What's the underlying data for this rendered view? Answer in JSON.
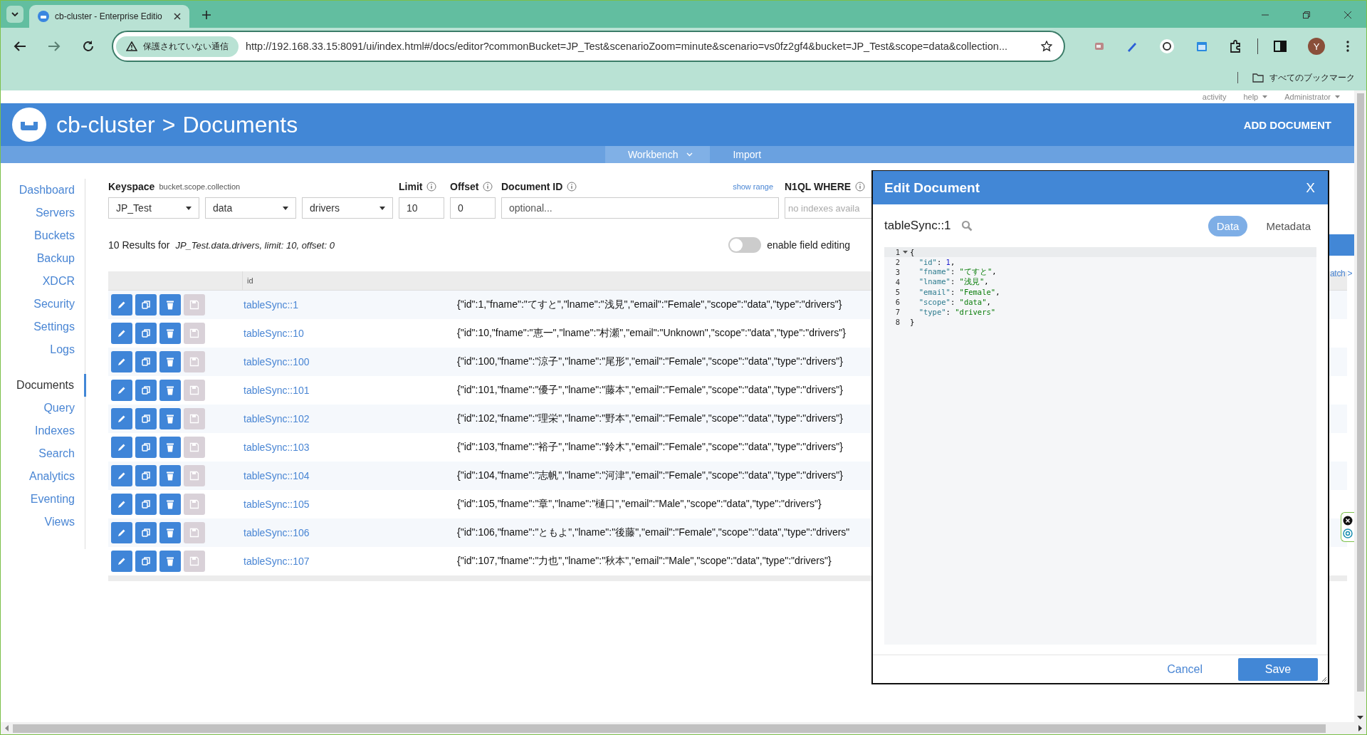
{
  "browser": {
    "tab_title": "cb-cluster - Enterprise Editio",
    "security_chip": "保護されていない通信",
    "url": "http://192.168.33.15:8091/ui/index.html#/docs/editor?commonBucket=JP_Test&scenarioZoom=minute&scenario=vs0fz2gf4&bucket=JP_Test&scope=data&collection...",
    "profile_initial": "Y",
    "bookmarks_label": "すべてのブックマーク"
  },
  "top_menu": [
    {
      "label": "activity",
      "dropdown": false
    },
    {
      "label": "help",
      "dropdown": true
    },
    {
      "label": "Administrator",
      "dropdown": true
    }
  ],
  "header": {
    "cluster": "cb-cluster",
    "separator": ">",
    "page": "Documents",
    "action": "ADD DOCUMENT"
  },
  "subnav": [
    {
      "label": "Workbench",
      "selected": true,
      "dropdown": true
    },
    {
      "label": "Import",
      "selected": false,
      "dropdown": false
    }
  ],
  "sidebar": {
    "groups": [
      [
        {
          "label": "Dashboard",
          "selected": false
        },
        {
          "label": "Servers",
          "selected": false
        },
        {
          "label": "Buckets",
          "selected": false
        },
        {
          "label": "Backup",
          "selected": false
        },
        {
          "label": "XDCR",
          "selected": false
        },
        {
          "label": "Security",
          "selected": false
        },
        {
          "label": "Settings",
          "selected": false
        },
        {
          "label": "Logs",
          "selected": false
        }
      ],
      [
        {
          "label": "Documents",
          "selected": true
        },
        {
          "label": "Query",
          "selected": false
        },
        {
          "label": "Indexes",
          "selected": false
        },
        {
          "label": "Search",
          "selected": false
        },
        {
          "label": "Analytics",
          "selected": false
        },
        {
          "label": "Eventing",
          "selected": false
        },
        {
          "label": "Views",
          "selected": false
        }
      ]
    ]
  },
  "filters": {
    "keyspace_label": "Keyspace",
    "keyspace_hint": "bucket.scope.collection",
    "selects": [
      "JP_Test",
      "data",
      "drivers"
    ],
    "limit": {
      "label": "Limit",
      "value": "10"
    },
    "offset": {
      "label": "Offset",
      "value": "0"
    },
    "document_id": {
      "label": "Document ID",
      "placeholder": "optional..."
    },
    "show_range": "show range",
    "where": {
      "label": "N1QL WHERE",
      "placeholder": "no indexes availa"
    }
  },
  "results": {
    "count": "10 Results for",
    "detail": "JP_Test.data.drivers, limit: 10, offset: 0",
    "toggle": {
      "label": "enable field editing",
      "on": false
    },
    "next_batch": "atch >"
  },
  "table": {
    "columns": [
      "id"
    ],
    "rows": [
      {
        "id": "tableSync::1",
        "json": "{\"id\":1,\"fname\":\"てすと\",\"lname\":\"浅見\",\"email\":\"Female\",\"scope\":\"data\",\"type\":\"drivers\"}",
        "save_disabled": true
      },
      {
        "id": "tableSync::10",
        "json": "{\"id\":10,\"fname\":\"恵一\",\"lname\":\"村瀬\",\"email\":\"Unknown\",\"scope\":\"data\",\"type\":\"drivers\"}",
        "save_disabled": true
      },
      {
        "id": "tableSync::100",
        "json": "{\"id\":100,\"fname\":\"涼子\",\"lname\":\"尾形\",\"email\":\"Female\",\"scope\":\"data\",\"type\":\"drivers\"}",
        "save_disabled": true
      },
      {
        "id": "tableSync::101",
        "json": "{\"id\":101,\"fname\":\"優子\",\"lname\":\"藤本\",\"email\":\"Female\",\"scope\":\"data\",\"type\":\"drivers\"}",
        "save_disabled": true
      },
      {
        "id": "tableSync::102",
        "json": "{\"id\":102,\"fname\":\"理栄\",\"lname\":\"野本\",\"email\":\"Female\",\"scope\":\"data\",\"type\":\"drivers\"}",
        "save_disabled": true
      },
      {
        "id": "tableSync::103",
        "json": "{\"id\":103,\"fname\":\"裕子\",\"lname\":\"鈴木\",\"email\":\"Female\",\"scope\":\"data\",\"type\":\"drivers\"}",
        "save_disabled": true
      },
      {
        "id": "tableSync::104",
        "json": "{\"id\":104,\"fname\":\"志帆\",\"lname\":\"河津\",\"email\":\"Female\",\"scope\":\"data\",\"type\":\"drivers\"}",
        "save_disabled": true
      },
      {
        "id": "tableSync::105",
        "json": "{\"id\":105,\"fname\":\"章\",\"lname\":\"樋口\",\"email\":\"Male\",\"scope\":\"data\",\"type\":\"drivers\"}",
        "save_disabled": true
      },
      {
        "id": "tableSync::106",
        "json": "{\"id\":106,\"fname\":\"ともよ\",\"lname\":\"後藤\",\"email\":\"Female\",\"scope\":\"data\",\"type\":\"drivers\"",
        "save_disabled": true
      },
      {
        "id": "tableSync::107",
        "json": "{\"id\":107,\"fname\":\"力也\",\"lname\":\"秋本\",\"email\":\"Male\",\"scope\":\"data\",\"type\":\"drivers\"}",
        "save_disabled": true
      }
    ]
  },
  "editor": {
    "title": "Edit Document",
    "close": "X",
    "doc_id": "tableSync::1",
    "tabs": [
      {
        "label": "Data",
        "selected": true
      },
      {
        "label": "Metadata",
        "selected": false
      }
    ],
    "lines": [
      {
        "number": "1",
        "text": "{",
        "foldable": true
      },
      {
        "number": "2",
        "text": "  \"id\": 1,",
        "foldable": false
      },
      {
        "number": "3",
        "text": "  \"fname\": \"てすと\",",
        "foldable": false
      },
      {
        "number": "4",
        "text": "  \"lname\": \"浅見\",",
        "foldable": false
      },
      {
        "number": "5",
        "text": "  \"email\": \"Female\",",
        "foldable": false
      },
      {
        "number": "6",
        "text": "  \"scope\": \"data\",",
        "foldable": false
      },
      {
        "number": "7",
        "text": "  \"type\": \"drivers\"",
        "foldable": false
      },
      {
        "number": "8",
        "text": "}",
        "foldable": false
      }
    ],
    "cancel": "Cancel",
    "save": "Save"
  }
}
